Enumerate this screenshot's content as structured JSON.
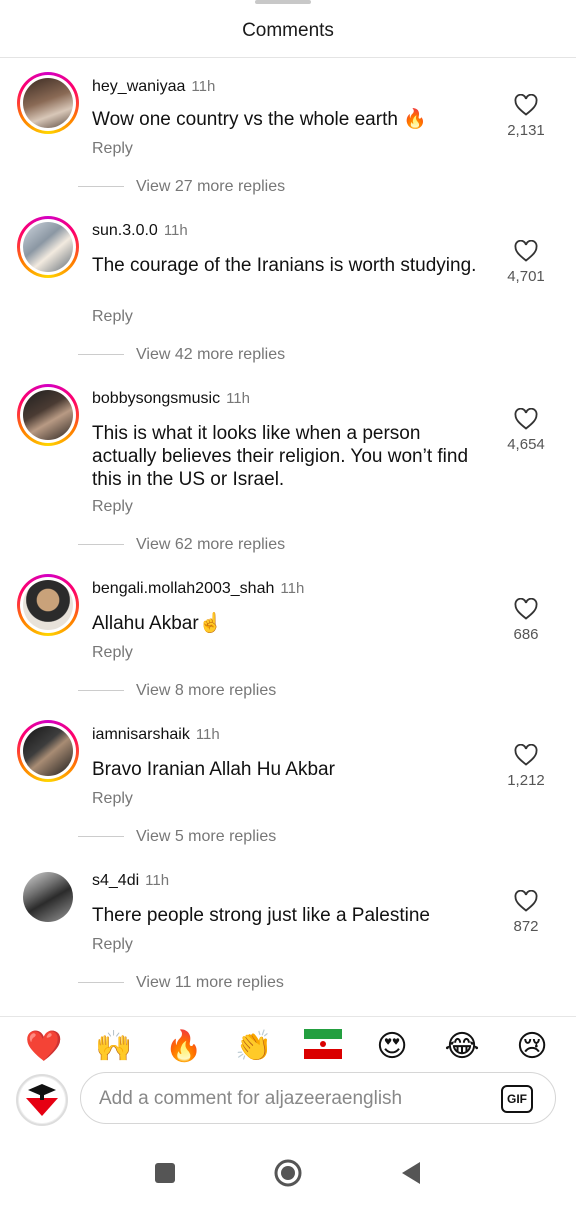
{
  "header": {
    "title": "Comments"
  },
  "comments": [
    {
      "username": "hey_waniyaa",
      "time": "11h",
      "text": "Wow one country vs the whole earth 🔥",
      "reply_label": "Reply",
      "likes": "2,131",
      "view_replies": "View 27 more replies"
    },
    {
      "username": "sun.3.0.0",
      "time": "11h",
      "text": "The courage of the Iranians is worth studying.",
      "reply_label": "Reply",
      "likes": "4,701",
      "view_replies": "View 42 more replies"
    },
    {
      "username": "bobbysongsmusic",
      "time": "11h",
      "text": "This is what it looks like when a person actually believes their religion. You won’t find this in the US or Israel.",
      "reply_label": "Reply",
      "likes": "4,654",
      "view_replies": "View 62 more replies"
    },
    {
      "username": "bengali.mollah2003_shah",
      "time": "11h",
      "text": "Allahu Akbar☝️",
      "reply_label": "Reply",
      "likes": "686",
      "view_replies": "View 8 more replies"
    },
    {
      "username": "iamnisarshaik",
      "time": "11h",
      "text": "Bravo Iranian Allah Hu Akbar",
      "reply_label": "Reply",
      "likes": "1,212",
      "view_replies": "View 5 more replies"
    },
    {
      "username": "s4_4di",
      "time": "11h",
      "text": "There people strong just like a Palestine",
      "reply_label": "Reply",
      "likes": "872",
      "view_replies": "View 11 more replies"
    }
  ],
  "emoji_bar": [
    "❤️",
    "🙌",
    "🔥",
    "👏",
    "🇮🇷",
    "😍",
    "😂",
    "😢"
  ],
  "composer": {
    "placeholder": "Add a comment for aljazeeraenglish",
    "gif_label": "GIF"
  },
  "icons": {
    "like": "heart-icon",
    "nav": [
      "square-icon",
      "circle-icon",
      "back-triangle-icon"
    ]
  }
}
